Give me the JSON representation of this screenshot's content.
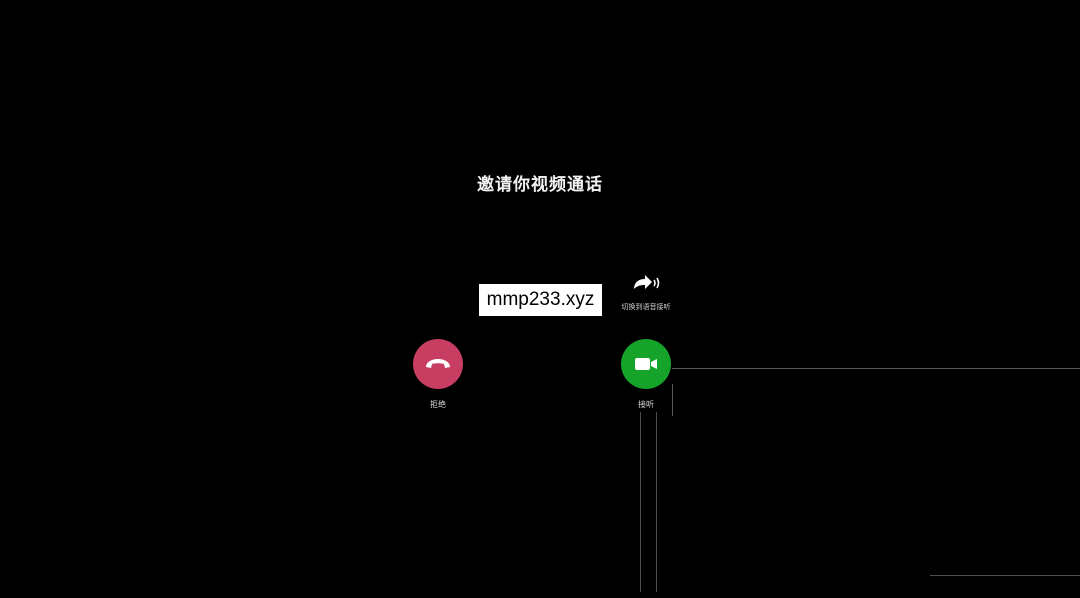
{
  "call": {
    "title": "邀请你视频通话"
  },
  "watermark": {
    "text": "mmp233.xyz"
  },
  "speaker": {
    "label": "切换到语音接听",
    "icon": "forward-speaker-icon"
  },
  "actions": {
    "decline": {
      "label": "拒绝",
      "icon": "hang-up-phone-icon",
      "color": "#c83e62"
    },
    "accept": {
      "label": "接听",
      "icon": "video-camera-icon",
      "color": "#16a329"
    }
  }
}
